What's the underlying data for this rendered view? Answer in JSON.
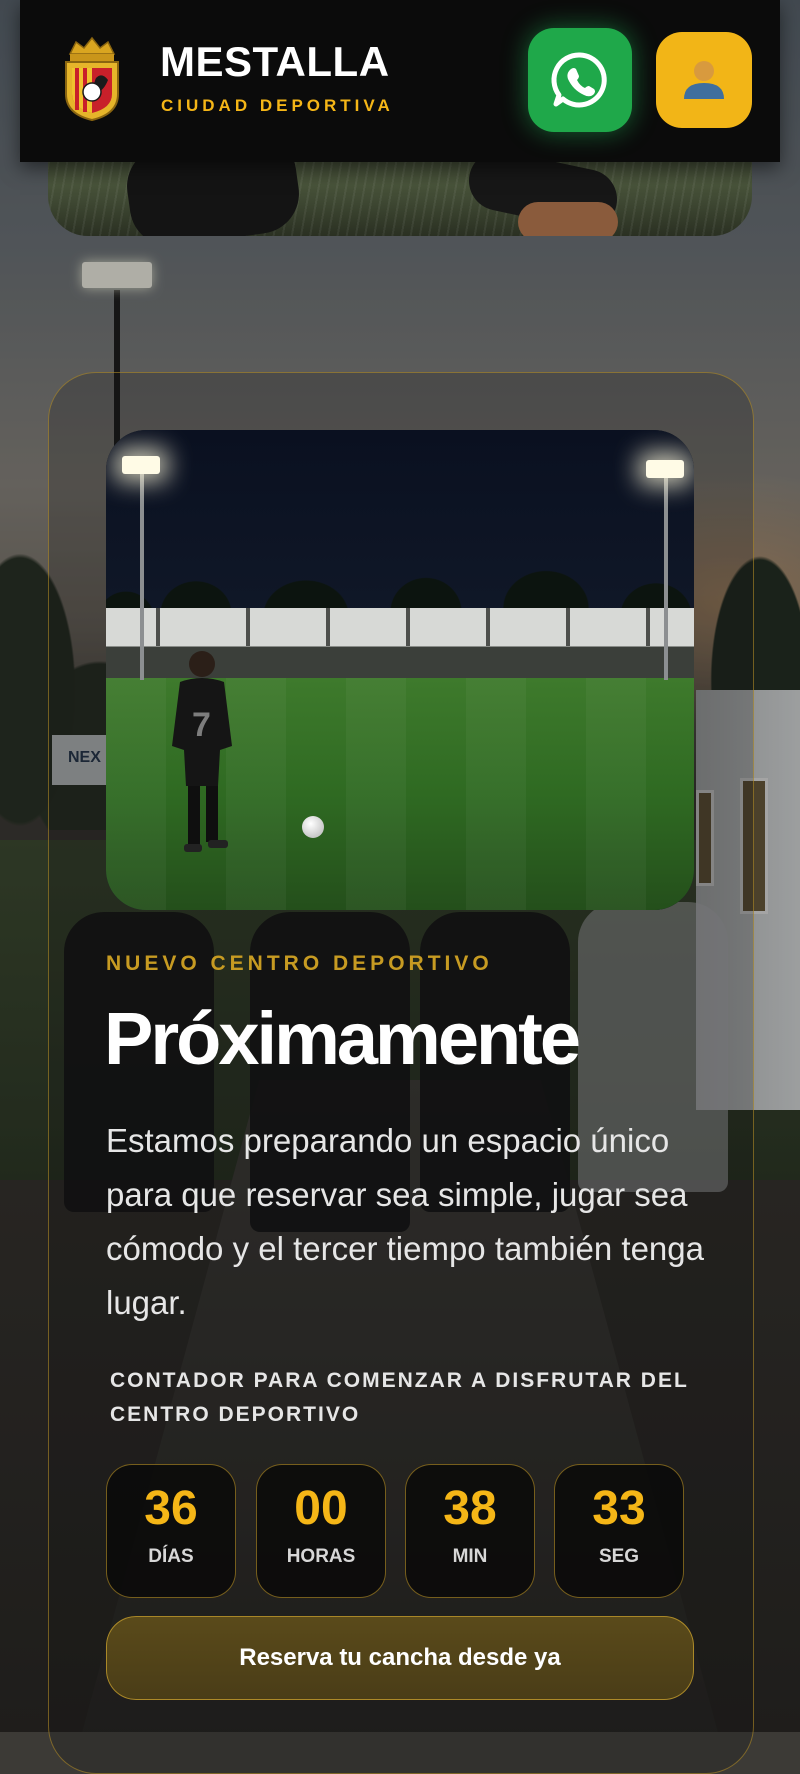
{
  "header": {
    "brand_name": "MESTALLA",
    "brand_sub": "CIUDAD DEPORTIVA",
    "whatsapp_icon": "whatsapp-icon",
    "user_icon": "user-icon"
  },
  "hero": {
    "player_number": "7"
  },
  "content": {
    "eyebrow": "NUEVO CENTRO DEPORTIVO",
    "title": "Próximamente",
    "description": "Estamos preparando un espacio único para que reservar sea simple, jugar sea cómodo y el tercer tiempo también tenga lugar.",
    "countdown_label": "CONTADOR PARA COMENZAR A DISFRUTAR DEL CENTRO DEPORTIVO"
  },
  "countdown": [
    {
      "value": "36",
      "unit": "DÍAS"
    },
    {
      "value": "00",
      "unit": "HORAS"
    },
    {
      "value": "38",
      "unit": "MIN"
    },
    {
      "value": "33",
      "unit": "SEG"
    }
  ],
  "cta": {
    "label": "Reserva tu cancha desde ya"
  },
  "background": {
    "sign_text": "NEX"
  },
  "colors": {
    "accent_gold": "#f5b617",
    "whatsapp_green": "#1fa84a",
    "header_bg": "#0b0b0b"
  }
}
